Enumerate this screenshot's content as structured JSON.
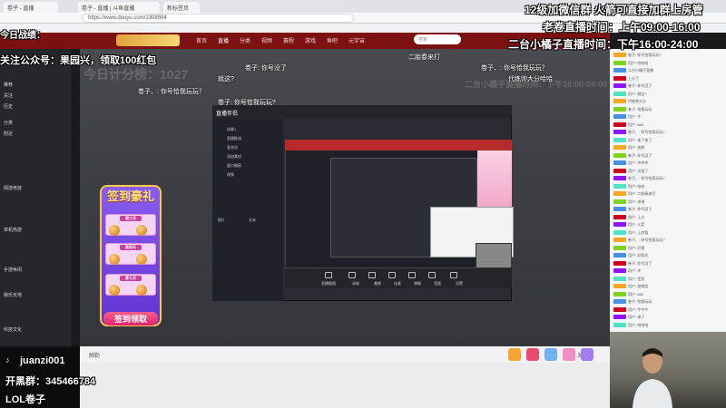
{
  "browser": {
    "tabs": [
      "卷子 - 直播",
      "卷子 - 直播 | 斗鱼直播",
      "新标签页"
    ],
    "url": "https://www.douyu.com/1308504"
  },
  "site": {
    "nav": [
      "首页",
      "直播",
      "分类",
      "视频",
      "赛程",
      "游戏",
      "鱼吧",
      "元宇宙"
    ],
    "search_placeholder": "搜索",
    "left_sections": [
      "推荐",
      "关注",
      "历史",
      "分类",
      "附近",
      "网游竞技",
      "单机热游",
      "手游休闲",
      "娱乐天地",
      "科技文化"
    ]
  },
  "overlay": {
    "top_right_1": "12级加微信群 火箭可直接加群上房管",
    "top_right_2": "老卷直播时间：上午09:00-16:00",
    "top_right_3": "二台小橘子直播时间：下午16:00-24:00",
    "top_left_1": "今日战绩：",
    "top_left_2": "关注公众号：果园兴，领取100红包",
    "bottom_left_handle": "juanzi001",
    "bottom_left_group": "开黑群：345466784",
    "bottom_left_name": "LOL卷子"
  },
  "ghost_text": {
    "score": "今日计分榜：1027",
    "record": "二台小橘子直播时间：下午16:00-24:00"
  },
  "danmu": [
    "卷子: 你号没了",
    "就这?",
    "卷子、: 你号恰我玩玩？",
    "卷子: 你号恰我玩玩?",
    "二胎春来打",
    "卷子、: 你号恰我玩玩？",
    "代练帅大分哈哈"
  ],
  "inner_window": {
    "title": "直播伴侣",
    "side_items": [
      "场景1",
      "直播推流",
      "麦克风",
      "添加素材",
      "窗口捕获",
      "视频",
      "图片",
      "文本"
    ],
    "toolbar": [
      "直播截图",
      "录制",
      "美颜",
      "连麦",
      "弹幕",
      "音量",
      "设置"
    ]
  },
  "signin": {
    "title": "签到豪礼",
    "days": [
      "第三天",
      "第四天",
      "第七天"
    ],
    "button": "签到领取"
  },
  "chat": {
    "messages": [
      "卷子: 你号恰我玩玩?",
      "用户: 哈哈哈",
      "二台小橘子直播",
      "上分了",
      "卷子: 你号没了",
      "用户: 就这?",
      "代练帅大分",
      "卷子: 恰我玩玩",
      "用户: 牛",
      "用户: 666",
      "卷子、: 你号恰我玩玩?",
      "用户: 来了来了",
      "用户: 加群",
      "卷子: 你号没了",
      "用户: 冲冲冲",
      "用户: 太强了",
      "卷子、: 你号恰我玩玩?",
      "用户: 哈哈",
      "用户: 二胎春来打",
      "用户: 求带",
      "卷子: 你号没了",
      "用户: 上分",
      "用户: 火箭",
      "用户: 上房管",
      "卷子、: 你号恰我玩玩?",
      "用户: 厉害",
      "用户: 好家伙",
      "卷子: 你号没了",
      "用户: 冲",
      "用户: 签到",
      "用户: 加微信",
      "用户: 666",
      "卷子: 恰我玩玩",
      "用户: 牛牛牛",
      "用户: 来了",
      "用户: 哈哈哈"
    ]
  },
  "player_bottom": {
    "left": "酬勤",
    "right": "发送"
  },
  "colors": {
    "site_header": "#7d1111",
    "signin_purple": "#7a4be6",
    "overlay_text": "#ffffff"
  }
}
